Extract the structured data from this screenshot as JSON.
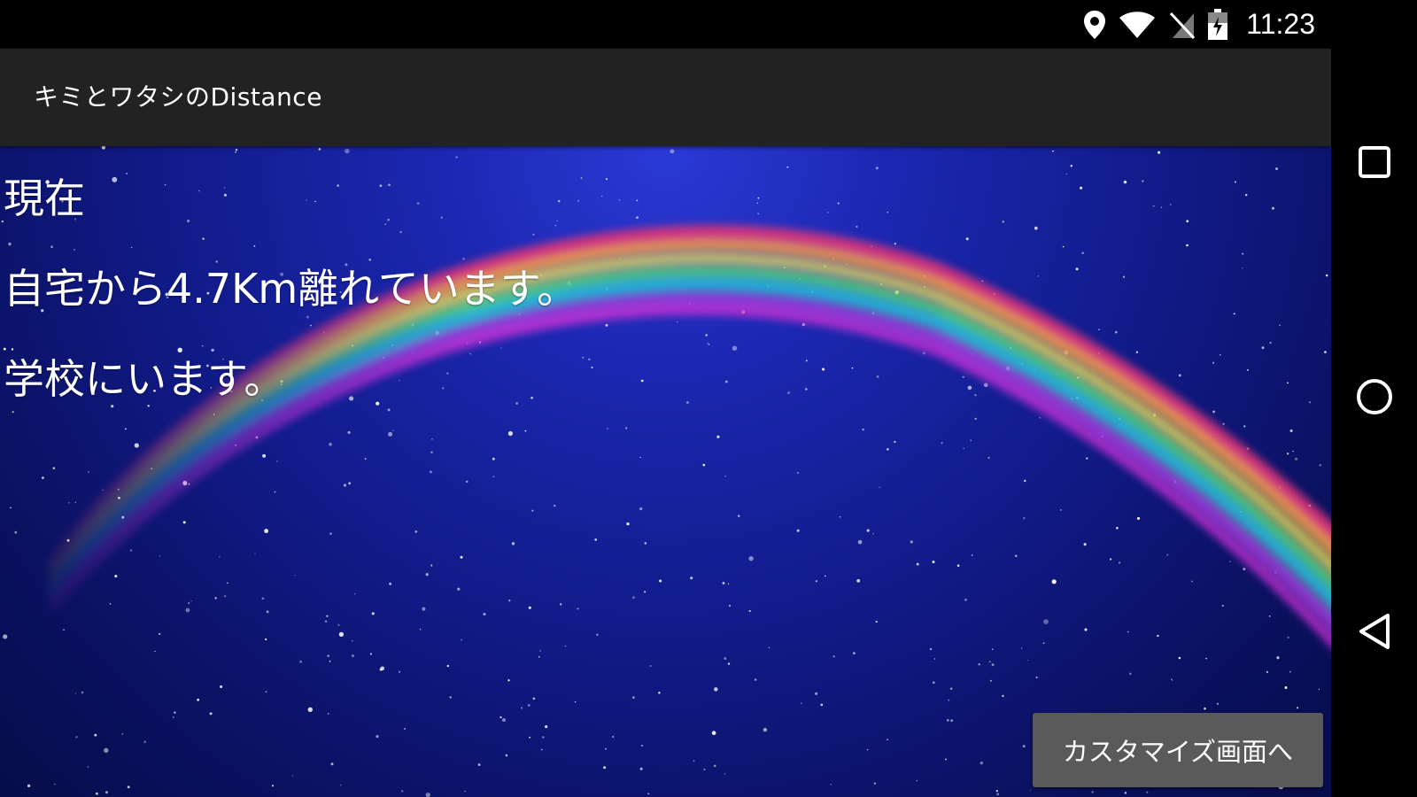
{
  "status_bar": {
    "time": "11:23",
    "icons": [
      "location-icon",
      "wifi-icon",
      "no-sim-icon",
      "battery-charging-icon"
    ]
  },
  "app_bar": {
    "title": "キミとワタシのDistance"
  },
  "main": {
    "line1": "現在",
    "line2": "自宅から4.7Km離れています。",
    "line3": "学校にいます。",
    "customize_button": "カスタマイズ画面へ"
  },
  "nav_bar": {
    "icons": [
      "recents-icon",
      "home-icon",
      "back-icon"
    ]
  },
  "colors": {
    "sky_top": "#2a3ad6",
    "sky_bottom": "#070c4a",
    "app_bar": "#222222",
    "button": "#5a5a5a",
    "text": "#ffffff"
  }
}
